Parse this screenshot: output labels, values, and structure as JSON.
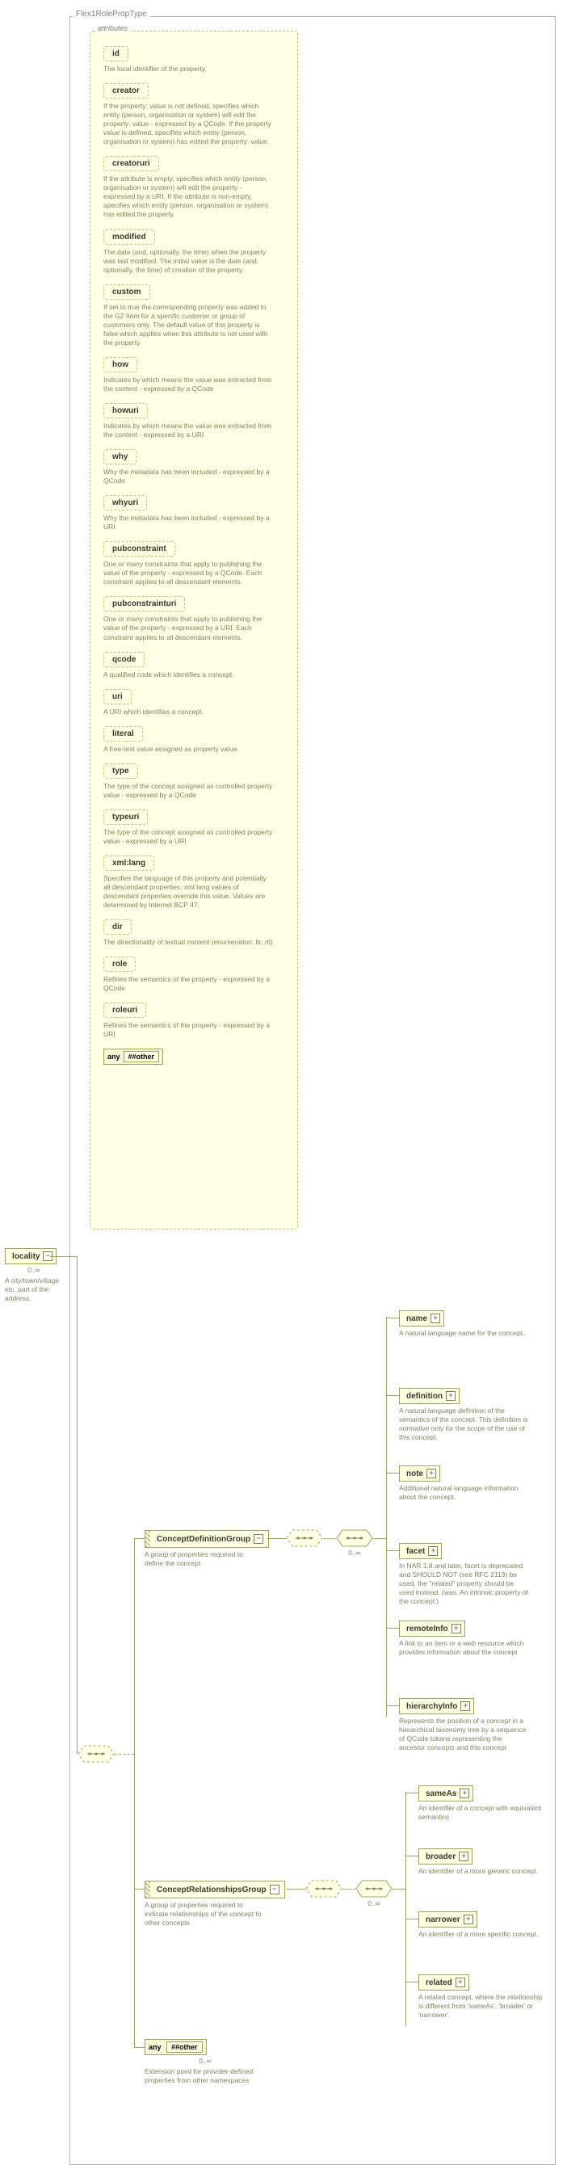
{
  "type_name": "Flex1RolePropType",
  "attributes_label": "attributes",
  "root": {
    "name": "locality",
    "occ": "0..∞",
    "desc": "A city/town/village etc. part of the address."
  },
  "attributes": [
    {
      "name": "id",
      "desc": "The local identifier of the property."
    },
    {
      "name": "creator",
      "desc": "If the property: value is not defined, specifies which entity (person, organisation or system) will edit the property: value - expressed by a QCode. If the property value is defined, specifies which entity (person, organisation or system) has edited the property: value."
    },
    {
      "name": "creatoruri",
      "desc": "If the attribute is empty, specifies which entity (person, organisation or system) will edit the property - expressed by a URI. If the attribute is non-empty, specifies which entity (person, organisation or system) has edited the property."
    },
    {
      "name": "modified",
      "desc": "The date (and, optionally, the time) when the property was last modified. The initial value is the date (and, optionally, the time) of creation of the property."
    },
    {
      "name": "custom",
      "desc": "If set to true the corresponding property was added to the G2 Item for a specific customer or group of customers only. The default value of this property is false which applies when this attribute is not used with the property."
    },
    {
      "name": "how",
      "desc": "Indicates by which means the value was extracted from the content - expressed by a QCode"
    },
    {
      "name": "howuri",
      "desc": "Indicates by which means the value was extracted from the content - expressed by a URI"
    },
    {
      "name": "why",
      "desc": "Why the metadata has been included - expressed by a QCode"
    },
    {
      "name": "whyuri",
      "desc": "Why the metadata has been included - expressed by a URI"
    },
    {
      "name": "pubconstraint",
      "desc": "One or many constraints that apply to publishing the value of the property - expressed by a QCode. Each constraint applies to all descendant elements."
    },
    {
      "name": "pubconstrainturi",
      "desc": "One or many constraints that apply to publishing the value of the property - expressed by a URI. Each constraint applies to all descendant elements."
    },
    {
      "name": "qcode",
      "desc": "A qualified code which identifies a concept."
    },
    {
      "name": "uri",
      "desc": "A URI which identifies a concept."
    },
    {
      "name": "literal",
      "desc": "A free-text value assigned as property value."
    },
    {
      "name": "type",
      "desc": "The type of the concept assigned as controlled property value - expressed by a QCode"
    },
    {
      "name": "typeuri",
      "desc": "The type of the concept assigned as controlled property value - expressed by a URI"
    },
    {
      "name": "xml:lang",
      "desc": "Specifies the language of this property and potentially all descendant properties. xml:lang values of descendant properties override this value. Values are determined by Internet BCP 47."
    },
    {
      "name": "dir",
      "desc": "The directionality of textual content (enumeration: ltr, rtl)"
    },
    {
      "name": "role",
      "desc": "Refines the semantics of the property - expressed by a QCode"
    },
    {
      "name": "roleuri",
      "desc": "Refines the semantics of the property - expressed by a URI"
    }
  ],
  "any_attr": {
    "label": "any",
    "value": "##other"
  },
  "group_def": {
    "name": "ConceptDefinitionGroup",
    "desc": "A group of properties required to define the concept",
    "occ": "0..∞",
    "children": [
      {
        "name": "name",
        "desc": "A natural language name for the concept."
      },
      {
        "name": "definition",
        "desc": "A natural language definition of the semantics of the concept. This definition is normative only for the scope of the use of this concept."
      },
      {
        "name": "note",
        "desc": "Additional natural language information about the concept."
      },
      {
        "name": "facet",
        "desc": "In NAR 1.8 and later, facet is deprecated and SHOULD NOT (see RFC 2119) be used, the \"related\" property should be used instead. (was: An intrinsic property of the concept.)"
      },
      {
        "name": "remoteInfo",
        "desc": "A link to an item or a web resource which provides information about the concept"
      },
      {
        "name": "hierarchyInfo",
        "desc": "Represents the position of a concept in a hierarchical taxonomy tree by a sequence of QCode tokens representing the ancestor concepts and this concept"
      }
    ]
  },
  "group_rel": {
    "name": "ConceptRelationshipsGroup",
    "desc": "A group of properties required to indicate relationships of the concept to other concepts",
    "occ": "0..∞",
    "children": [
      {
        "name": "sameAs",
        "desc": "An identifier of a concept with equivalent semantics"
      },
      {
        "name": "broader",
        "desc": "An identifier of a more generic concept."
      },
      {
        "name": "narrower",
        "desc": "An identifier of a more specific concept."
      },
      {
        "name": "related",
        "desc": "A related concept, where the relationship is different from 'sameAs', 'broader' or 'narrower'."
      }
    ]
  },
  "any_elem": {
    "label": "any",
    "value": "##other",
    "occ": "0..∞",
    "desc": "Extension point for provider-defined properties from other namespaces"
  }
}
